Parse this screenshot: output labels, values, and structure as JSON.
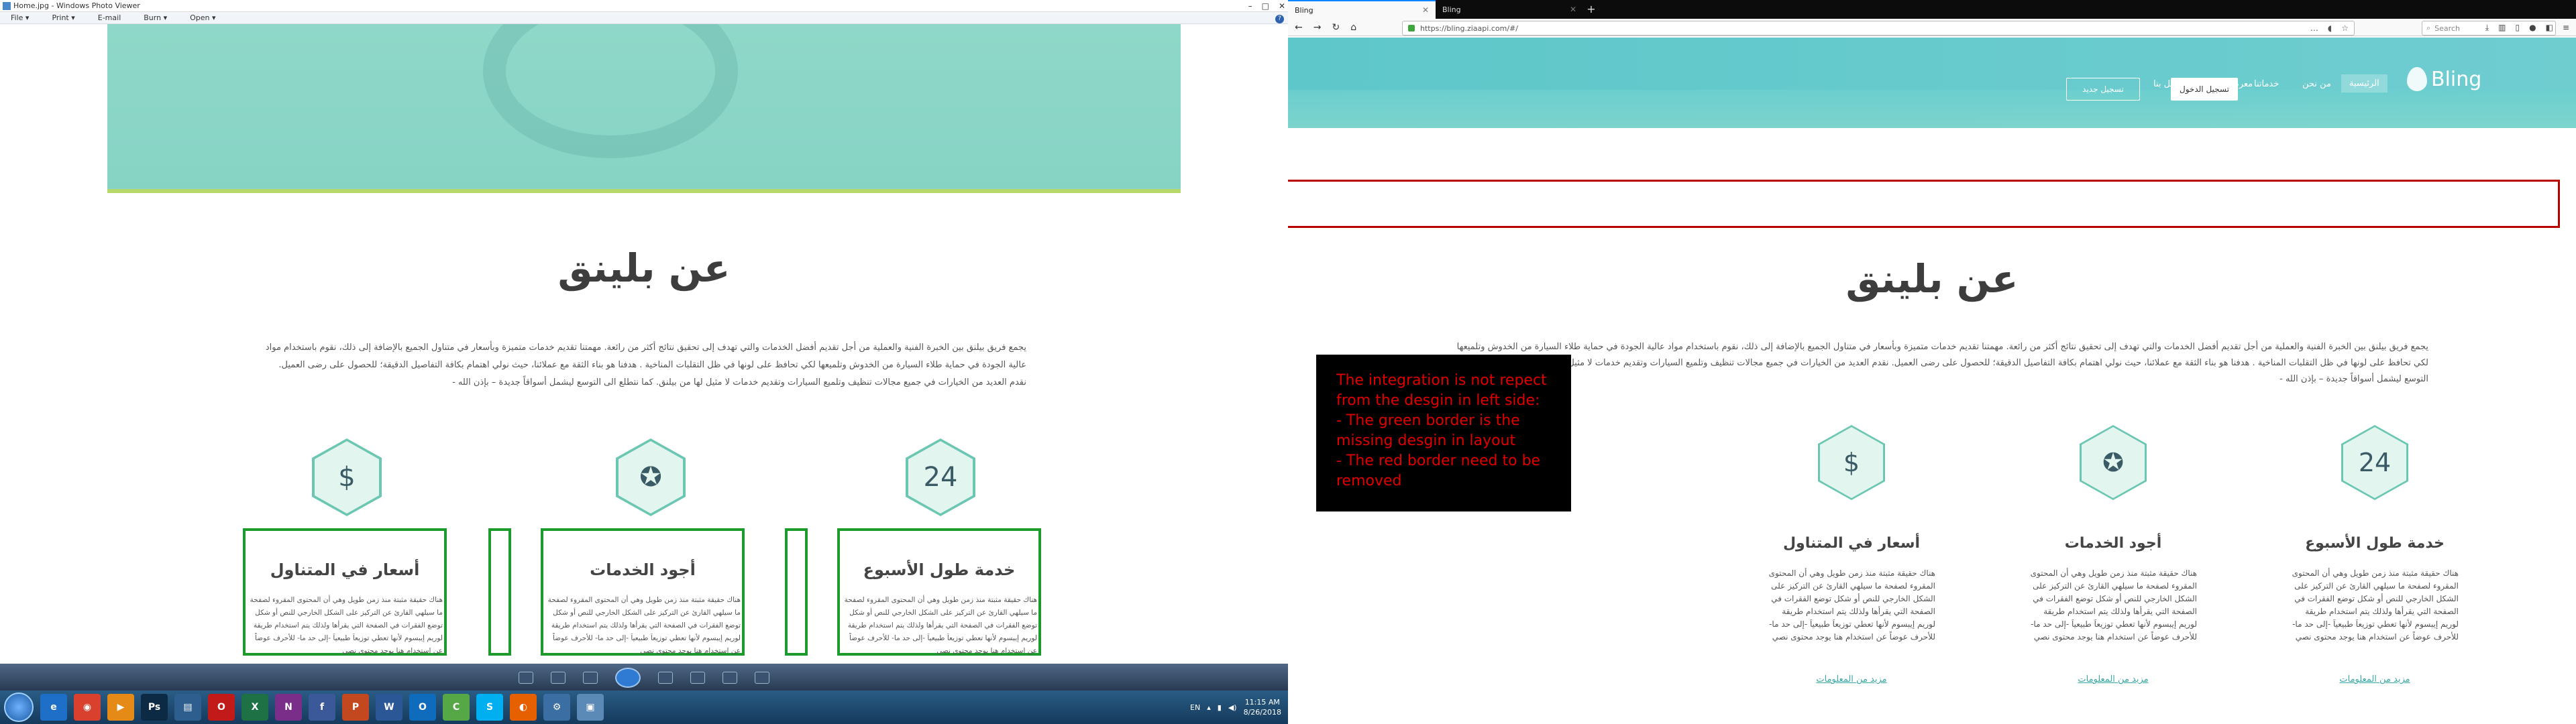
{
  "photo_viewer": {
    "title": "Home.jpg - Windows Photo Viewer",
    "menu": [
      "File ▾",
      "Print ▾",
      "E-mail",
      "Burn ▾",
      "Open ▾"
    ],
    "help": "?",
    "about_heading": "عن بلينق",
    "about_paragraph": "يجمع فريق بيلنق بين الخبرة الفنية والعملية من أجل تقديم أفضل الخدمات والتي تهدف إلى تحقيق نتائج أكثر من رائعة. مهمتنا تقديم خدمات متميزة وبأسعار في متناول الجميع بالإضافة إلى ذلك، نقوم باستخدام مواد عالية الجودة في حماية طلاء السيارة من الخدوش وتلميعها لكي تحافظ على لونها في ظل التقلبات المناخية . هدفنا هو بناء الثقة مع عملائنا، حيث نولي اهتمام بكافة التفاصيل الدقيقة؛ للحصول على رضى العميل. نقدم العديد من الخيارات في جميع مجالات تنظيف وتلميع السيارات وتقديم خدمات لا مثيل لها من بيلنق. كما نتطلع الى التوسع ليشمل أسواقاً جديدة – بإذن الله -",
    "cards": [
      {
        "title": "خدمة طول الأسبوع",
        "icon": "24h-icon",
        "text": "هناك حقيقة مثبتة منذ زمن طويل وهي أن المحتوى المقروء لصفحة ما سيلهي القارئ عن التركيز على الشكل الخارجي للنص أو شكل توضع الفقرات في الصفحة التي يقرأها ولذلك يتم استخدام طريقة لوريم إيبسوم لأنها تعطي توزيعاَ طبيعياَ -إلى حد ما- للأحرف عوضاً عن استخدام هنا يوجد محتوى نصي"
      },
      {
        "title": "أجود الخدمات",
        "icon": "quality-badge-icon",
        "text": "هناك حقيقة مثبتة منذ زمن طويل وهي أن المحتوى المقروء لصفحة ما سيلهي القارئ عن التركيز على الشكل الخارجي للنص أو شكل توضع الفقرات في الصفحة التي يقرأها ولذلك يتم استخدام طريقة لوريم إيبسوم لأنها تعطي توزيعاَ طبيعياَ -إلى حد ما- للأحرف عوضاً عن استخدام هنا يوجد محتوى نصي"
      },
      {
        "title": "أسعار في المتناول",
        "icon": "dollar-icon",
        "text": "هناك حقيقة مثبتة منذ زمن طويل وهي أن المحتوى المقروء لصفحة ما سيلهي القارئ عن التركيز على الشكل الخارجي للنص أو شكل توضع الفقرات في الصفحة التي يقرأها ولذلك يتم استخدام طريقة لوريم إيبسوم لأنها تعطي توزيعاَ طبيعياَ -إلى حد ما- للأحرف عوضاً عن استخدام هنا يوجد محتوى نصي"
      }
    ]
  },
  "taskbar": {
    "apps": [
      {
        "name": "ie-icon",
        "label": "e",
        "color": "#1e6fc8"
      },
      {
        "name": "chrome-icon",
        "label": "◉",
        "color": "#d9412e"
      },
      {
        "name": "media-player-icon",
        "label": "▶",
        "color": "#e58a16"
      },
      {
        "name": "photoshop-icon",
        "label": "Ps",
        "color": "#0d2a44"
      },
      {
        "name": "files-icon",
        "label": "▤",
        "color": "#2d5e8e"
      },
      {
        "name": "opera-icon",
        "label": "O",
        "color": "#c21919"
      },
      {
        "name": "excel-icon",
        "label": "X",
        "color": "#1e7145"
      },
      {
        "name": "onenote-icon",
        "label": "N",
        "color": "#7a2e8a"
      },
      {
        "name": "facebook-icon",
        "label": "f",
        "color": "#3b5998"
      },
      {
        "name": "powerpoint-icon",
        "label": "P",
        "color": "#c4481f"
      },
      {
        "name": "word-icon",
        "label": "W",
        "color": "#2b5797"
      },
      {
        "name": "outlook-icon",
        "label": "O",
        "color": "#0f6cbd"
      },
      {
        "name": "camtasia-icon",
        "label": "C",
        "color": "#56a846"
      },
      {
        "name": "skype-icon",
        "label": "S",
        "color": "#00aff0"
      },
      {
        "name": "firefox-icon",
        "label": "◐",
        "color": "#e66000"
      },
      {
        "name": "settings-icon",
        "label": "⚙",
        "color": "#3b6fa3"
      },
      {
        "name": "photo-viewer-icon",
        "label": "▣",
        "color": "#5a8ab5"
      }
    ],
    "lang": "EN",
    "time": "11:15 AM",
    "date": "8/26/2018"
  },
  "firefox": {
    "tabs": [
      {
        "label": "Bling",
        "active": true
      },
      {
        "label": "Bling",
        "active": false
      }
    ],
    "new_tab": "+",
    "url": "https://bling.ziaapi.com/#/",
    "search_placeholder": "Search",
    "site": {
      "logo_text": "Bling",
      "nav": [
        "الرئيسية",
        "من نحن",
        "خدماتنا",
        "معرض الصور",
        "إتصل بنا"
      ],
      "login_button": "تسجيل الدخول",
      "register_button": "تسجيل جديد",
      "about_heading": "عن بلينق",
      "about_paragraph": "يجمع فريق بيلنق بين الخبرة الفنية والعملية من أجل تقديم أفضل الخدمات والتي تهدف إلى تحقيق نتائج أكثر من رائعة. مهمتنا تقديم خدمات متميزة وبأسعار في متناول الجميع بالإضافة إلى ذلك، نقوم باستخدام مواد عالية الجودة في حماية طلاء السيارة من الخدوش وتلميعها لكي تحافظ على لونها في ظل التقلبات المناخية . هدفنا هو بناء الثقة مع عملائنا، حيث نولي اهتمام بكافة التفاصيل الدقيقة؛ للحصول على رضى العميل. نقدم العديد من الخيارات في جميع مجالات تنظيف وتلميع السيارات وتقديم خدمات لا مثيل لها من بيلنق. كما نتطلع الى التوسع ليشمل أسواقاً جديدة – بإذن الله -",
      "cards": [
        {
          "title": "خدمة طول الأسبوع",
          "icon": "24h-icon",
          "text": "هناك حقيقة مثبتة منذ زمن طويل وهي أن المحتوى المقروء لصفحة ما سيلهي القارئ عن التركيز على الشكل الخارجي للنص أو شكل توضع الفقرات في الصفحة التي يقرأها ولذلك يتم استخدام طريقة لوريم إيبسوم لأنها تعطي توزيعاَ طبيعياَ -إلى حد ما- للأحرف عوضاً عن استخدام هنا يوجد محتوى نصي",
          "more": "مزيد من المعلومات"
        },
        {
          "title": "أجود الخدمات",
          "icon": "quality-badge-icon",
          "text": "هناك حقيقة مثبتة منذ زمن طويل وهي أن المحتوى المقروء لصفحة ما سيلهي القارئ عن التركيز على الشكل الخارجي للنص أو شكل توضع الفقرات في الصفحة التي يقرأها ولذلك يتم استخدام طريقة لوريم إيبسوم لأنها تعطي توزيعاَ طبيعياَ -إلى حد ما- للأحرف عوضاً عن استخدام هنا يوجد محتوى نصي",
          "more": "مزيد من المعلومات"
        },
        {
          "title": "أسعار في المتناول",
          "icon": "dollar-icon",
          "text": "هناك حقيقة مثبتة منذ زمن طويل وهي أن المحتوى المقروء لصفحة ما سيلهي القارئ عن التركيز على الشكل الخارجي للنص أو شكل توضع الفقرات في الصفحة التي يقرأها ولذلك يتم استخدام طريقة لوريم إيبسوم لأنها تعطي توزيعاَ طبيعياَ -إلى حد ما- للأحرف عوضاً عن استخدام هنا يوجد محتوى نصي",
          "more": "مزيد من المعلومات"
        }
      ]
    }
  },
  "annotation_note": {
    "lines": [
      "The integration is not repect from the desgin in left side:",
      "- The green border is the missing desgin in layout",
      "- The red border need to be removed"
    ]
  },
  "colors": {
    "accent_green_border": "#1c9a2c",
    "accent_red_border": "#b70000",
    "brand_teal": "#5ec7c9"
  }
}
